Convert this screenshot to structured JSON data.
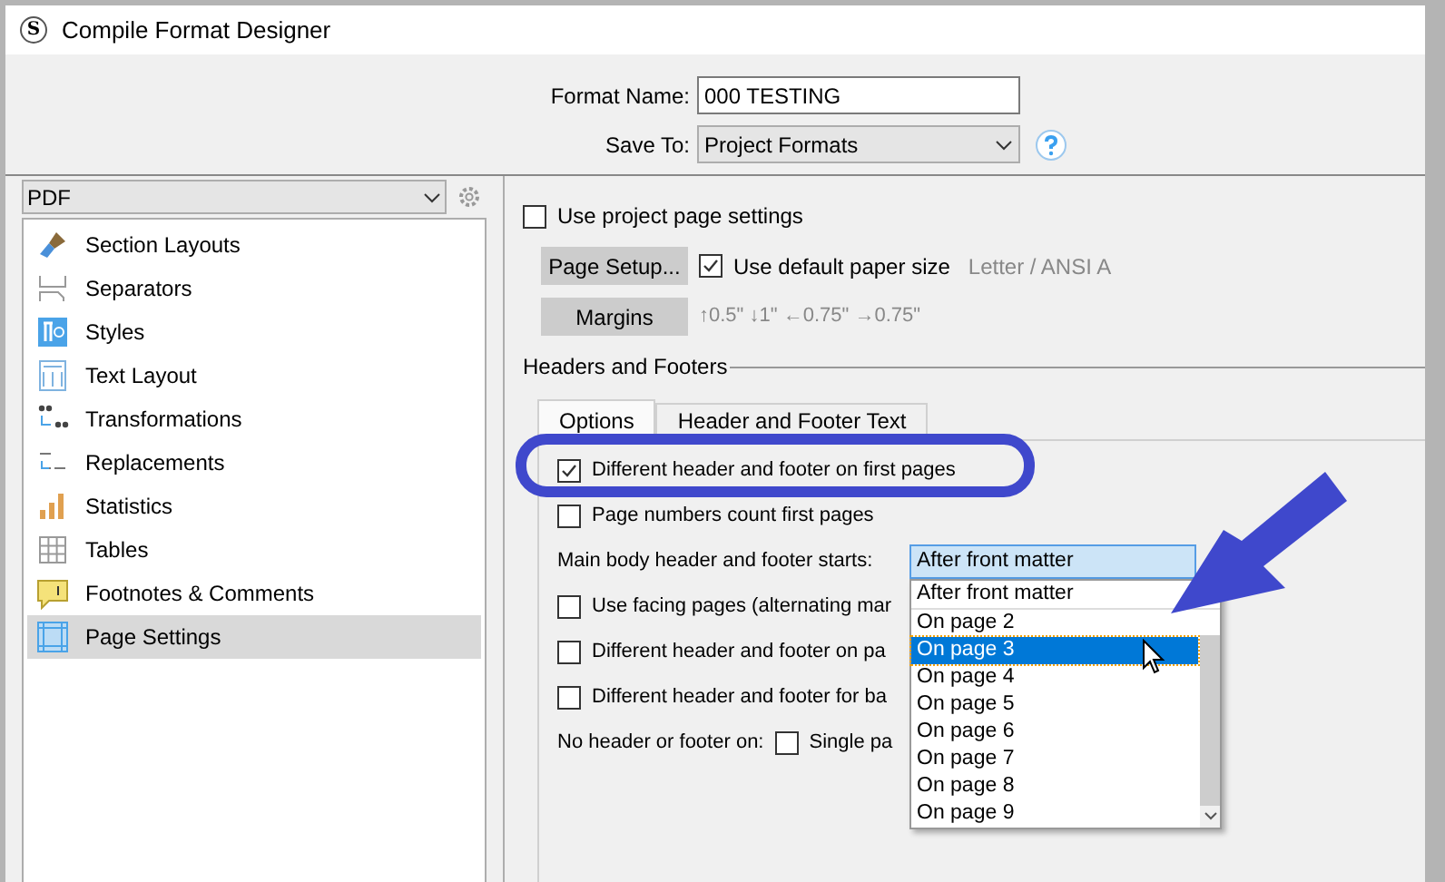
{
  "window": {
    "icon_text": "S",
    "title": "Compile Format Designer"
  },
  "format_name": {
    "label": "Format Name:",
    "value": "000 TESTING"
  },
  "save_to": {
    "label": "Save To:",
    "value": "Project Formats"
  },
  "format_select": {
    "value": "PDF"
  },
  "sidebar": {
    "items": [
      {
        "label": "Section Layouts",
        "selected": false
      },
      {
        "label": "Separators",
        "selected": false
      },
      {
        "label": "Styles",
        "selected": false
      },
      {
        "label": "Text Layout",
        "selected": false
      },
      {
        "label": "Transformations",
        "selected": false
      },
      {
        "label": "Replacements",
        "selected": false
      },
      {
        "label": "Statistics",
        "selected": false
      },
      {
        "label": "Tables",
        "selected": false
      },
      {
        "label": "Footnotes & Comments",
        "selected": false
      },
      {
        "label": "Page Settings",
        "selected": true
      }
    ]
  },
  "page": {
    "use_project_settings": {
      "label": "Use project page settings",
      "checked": false
    },
    "page_setup_button": "Page Setup...",
    "default_paper": {
      "label": "Use default paper size",
      "checked": true
    },
    "paper_size": "Letter / ANSI A",
    "margins_button": "Margins",
    "margins": "↑0.5\" ↓1\" ←0.75\" →0.75\""
  },
  "headers_footers": {
    "title": "Headers and Footers",
    "tabs": [
      {
        "label": "Options",
        "selected": true
      },
      {
        "label": "Header and Footer Text",
        "selected": false
      }
    ],
    "options": [
      {
        "kind": "checkbox",
        "label": "Different header and footer on first pages",
        "checked": true
      },
      {
        "kind": "checkbox",
        "label": "Page numbers count first pages",
        "checked": false
      },
      {
        "kind": "select",
        "label": "Main body header and footer starts:",
        "value": "After front matter"
      },
      {
        "kind": "checkbox",
        "label": "Use facing pages (alternating mar",
        "checked": false
      },
      {
        "kind": "checkbox",
        "label": "Different header and footer on pa",
        "checked": false
      },
      {
        "kind": "checkbox",
        "label": "Different header and footer for ba",
        "checked": false
      },
      {
        "kind": "inline",
        "label": "No header or footer on:",
        "option": {
          "label": "Single pa",
          "checked": false
        }
      }
    ]
  },
  "dropdown": {
    "items": [
      {
        "label": "After front matter",
        "selected": false
      },
      {
        "label": "On page 2",
        "selected": false
      },
      {
        "label": "On page 3",
        "selected": true
      },
      {
        "label": "On page 4",
        "selected": false
      },
      {
        "label": "On page 5",
        "selected": false
      },
      {
        "label": "On page 6",
        "selected": false
      },
      {
        "label": "On page 7",
        "selected": false
      },
      {
        "label": "On page 8",
        "selected": false
      },
      {
        "label": "On page 9",
        "selected": false
      }
    ]
  }
}
